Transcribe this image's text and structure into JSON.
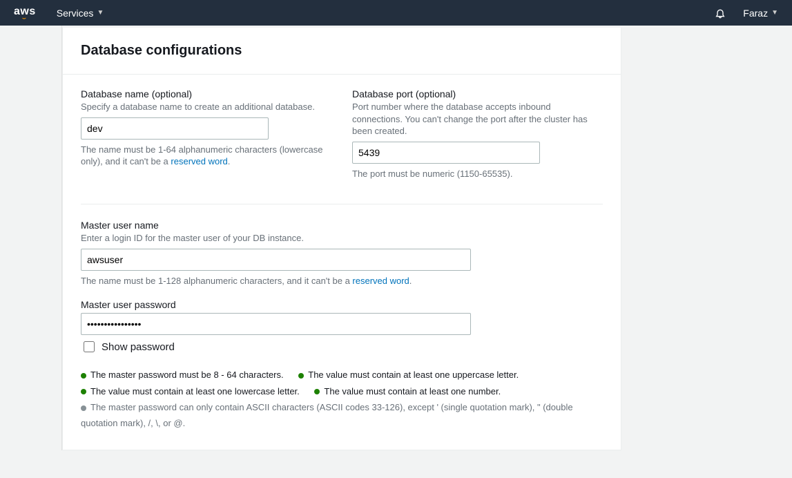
{
  "topbar": {
    "brand_text": "aws",
    "services_label": "Services",
    "user_name": "Faraz"
  },
  "card": {
    "title": "Database configurations"
  },
  "db_name": {
    "label": "Database name (optional)",
    "desc": "Specify a database name to create an additional database.",
    "value": "dev",
    "hint_pre": "The name must be 1-64 alphanumeric characters (lowercase only), and it can't be a ",
    "hint_link": "reserved word",
    "hint_post": "."
  },
  "db_port": {
    "label": "Database port (optional)",
    "desc": "Port number where the database accepts inbound connections. You can't change the port after the cluster has been created.",
    "value": "5439",
    "hint": "The port must be numeric (1150-65535)."
  },
  "master_user": {
    "label": "Master user name",
    "desc": "Enter a login ID for the master user of your DB instance.",
    "value": "awsuser",
    "hint_pre": "The name must be 1-128 alphanumeric characters, and it can't be a ",
    "hint_link": "reserved word",
    "hint_post": "."
  },
  "master_pw": {
    "label": "Master user password",
    "value": "••••••••••••••••",
    "show_label": "Show password"
  },
  "rules": {
    "r1": "The master password must be 8 - 64 characters.",
    "r2": "The value must contain at least one uppercase letter.",
    "r3": "The value must contain at least one lowercase letter.",
    "r4": "The value must contain at least one number.",
    "r5": "The master password can only contain ASCII characters (ASCII codes 33-126), except ' (single quotation mark), \" (double quotation mark), /, \\, or @."
  }
}
